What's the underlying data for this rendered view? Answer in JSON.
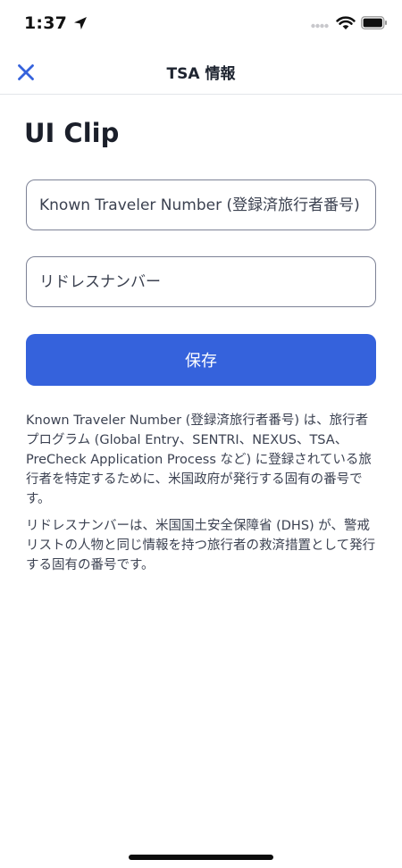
{
  "status_bar": {
    "time": "1:37"
  },
  "nav": {
    "title": "TSA 情報",
    "close_icon": "close-icon",
    "accent_color": "#3562dc"
  },
  "page": {
    "title": "UI Clip"
  },
  "fields": {
    "known_traveler_placeholder": "Known Traveler Number (登録済旅行者番号)",
    "redress_placeholder": "リドレスナンバー"
  },
  "save_button": {
    "label": "保存"
  },
  "descriptions": {
    "known_traveler": "Known Traveler Number (登録済旅行者番号) は、旅行者プログラム (Global Entry、SENTRI、NEXUS、TSA、PreCheck Application Process など) に登録されている旅行者を特定するために、米国政府が発行する固有の番号です。",
    "redress": "リドレスナンバーは、米国国土安全保障省 (DHS) が、警戒リストの人物と同じ情報を持つ旅行者の救済措置として発行する固有の番号です。"
  }
}
